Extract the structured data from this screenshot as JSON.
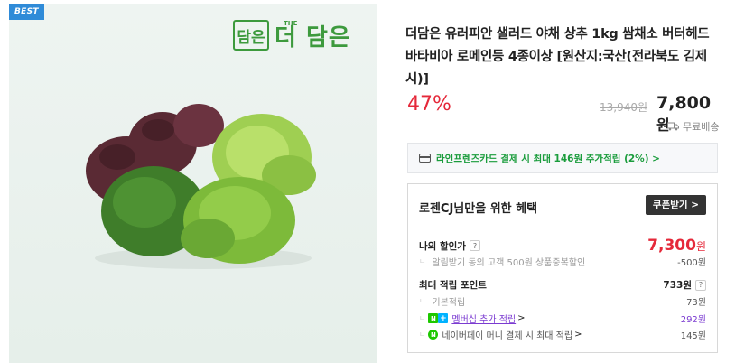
{
  "image": {
    "badge": "BEST",
    "logo_box": "담은",
    "logo_small": "THE",
    "logo_text": "더 담은"
  },
  "product": {
    "title": "더담은 유러피안 샐러드 야채 상추 1kg 쌈채소 버터헤드 바타비아 로메인등 4종이상 [원산지:국산(전라북도 김제시)]",
    "discount_rate": "47%",
    "original_price": "13,940원",
    "sale_price": "7,800",
    "sale_currency": "원",
    "shipping": "무료배송"
  },
  "card_promo": {
    "text": "라인프렌즈카드 결제 시 최대 146원 추가적립 (2%) >"
  },
  "benefit": {
    "title": "로젠CJ님만을 위한 혜택",
    "coupon_button": "쿠폰받기 >",
    "my_discount_label": "나의 할인가",
    "help_glyph": "?",
    "my_discount_value": "7,300",
    "my_discount_currency": "원",
    "alarm_label": "알림받기 동의 고객 500원 상품중복할인",
    "alarm_value": "-500원",
    "points_label": "최대 적립 포인트",
    "points_value": "733원",
    "base_label": "기본적립",
    "base_value": "73원",
    "membership_badge_n": "N",
    "membership_badge_plus": "+",
    "membership_label": "멤버십 추가 적립",
    "membership_value": "292원",
    "npay_badge": "N",
    "npay_label": "네이버페이 머니 결제 시 최대 적립",
    "npay_value": "145원",
    "chevron": ">"
  },
  "colors": {
    "accent_red": "#e5293a",
    "naver_green": "#1ec800",
    "best_blue": "#2f8bd8",
    "membership_purple": "#7b3bd1",
    "promo_green": "#1a9c3c"
  }
}
